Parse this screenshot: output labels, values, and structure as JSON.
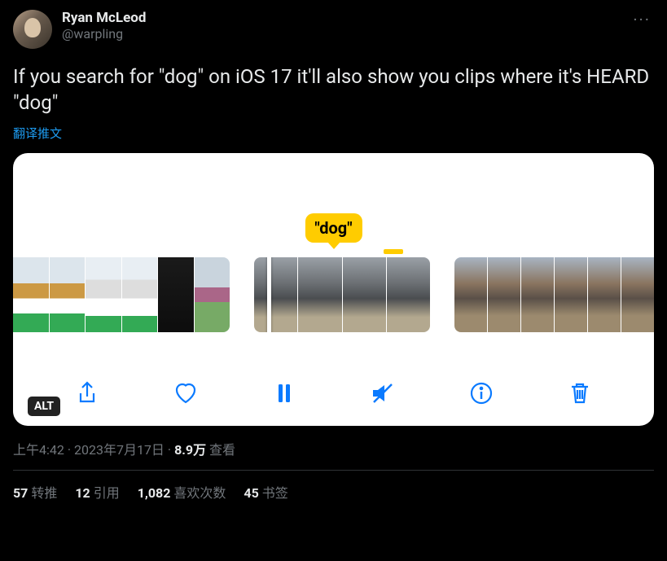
{
  "author": {
    "display_name": "Ryan McLeod",
    "handle": "@warpling"
  },
  "body": "If you search for \"dog\" on iOS 17 it'll also show you clips where it's HEARD \"dog\"",
  "translate_label": "翻译推文",
  "media": {
    "tooltip": "\"dog\"",
    "alt_badge": "ALT"
  },
  "meta": {
    "time": "上午4:42",
    "date": "2023年7月17日",
    "views_count": "8.9万",
    "views_label": "查看"
  },
  "stats": {
    "retweets_count": "57",
    "retweets_label": "转推",
    "quotes_count": "12",
    "quotes_label": "引用",
    "likes_count": "1,082",
    "likes_label": "喜欢次数",
    "bookmarks_count": "45",
    "bookmarks_label": "书签"
  }
}
